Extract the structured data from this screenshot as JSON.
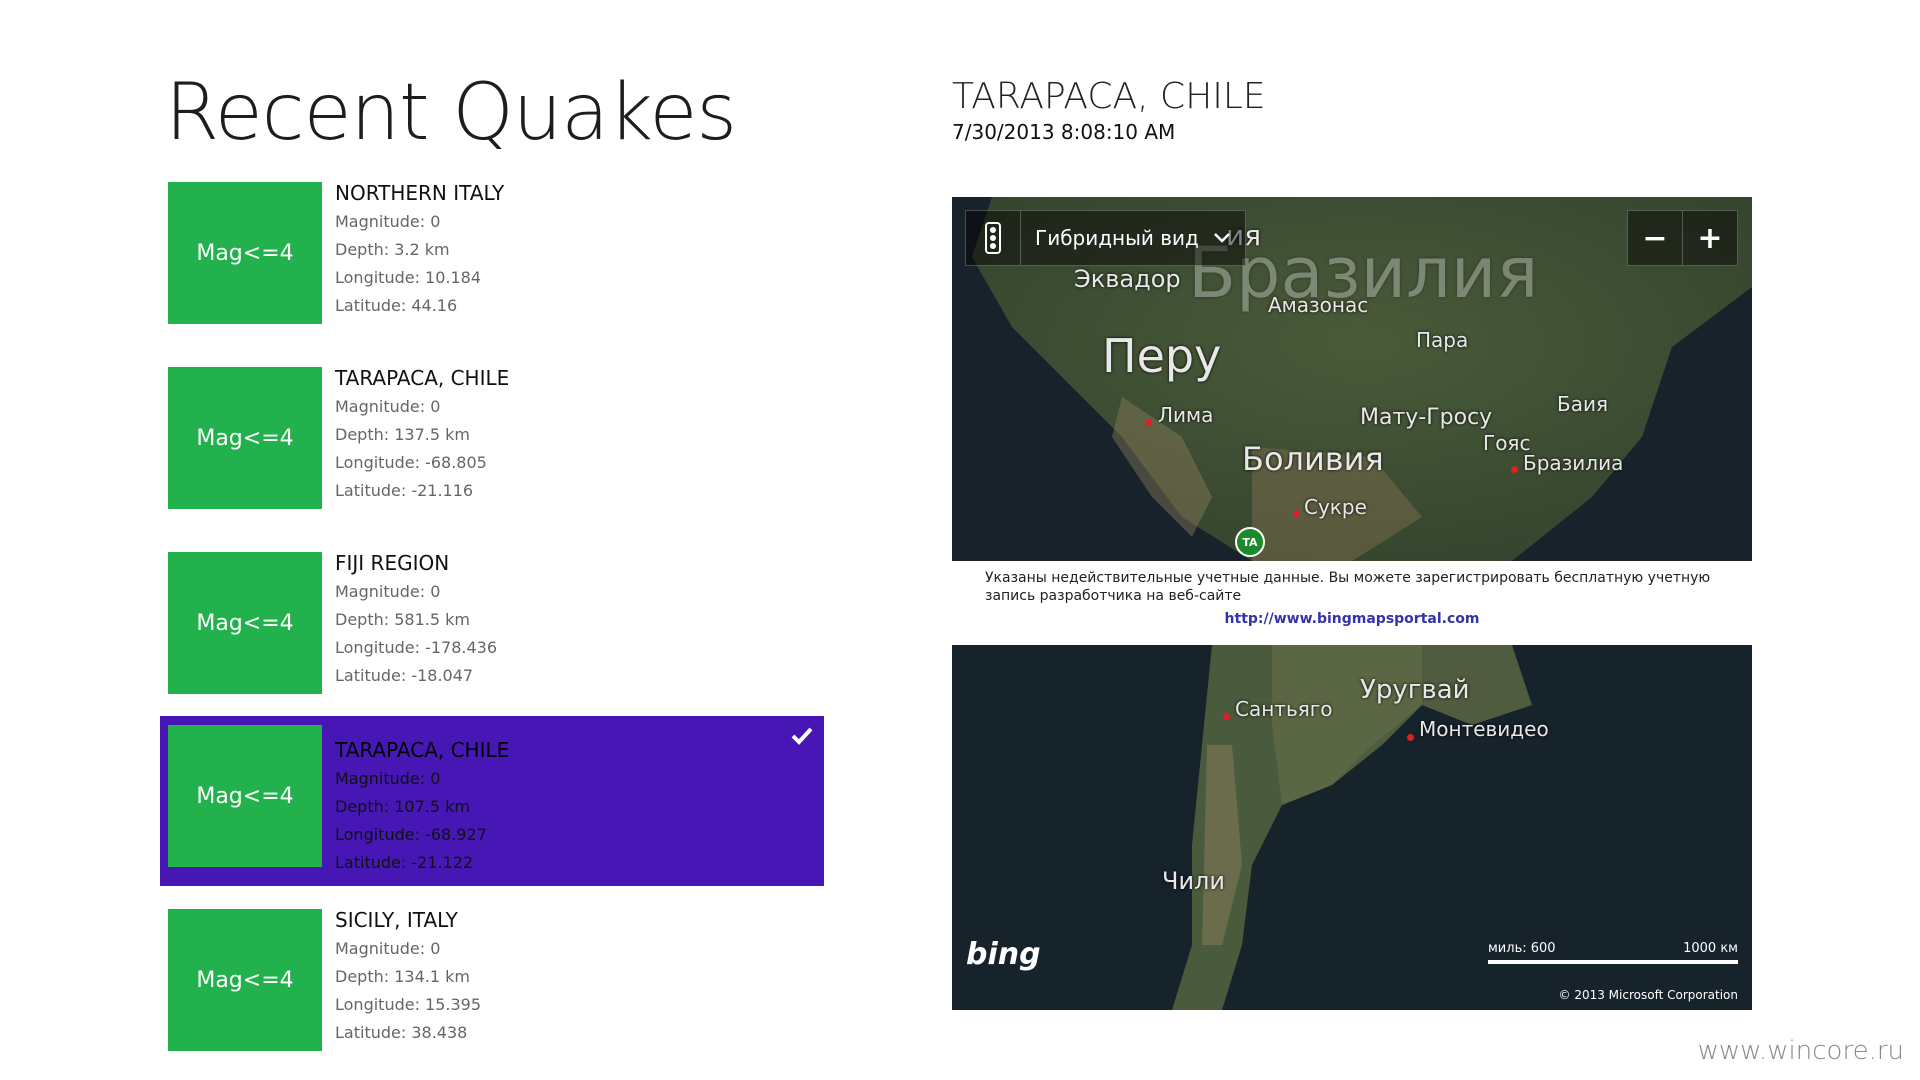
{
  "page": {
    "title": "Recent Quakes"
  },
  "quakes": [
    {
      "tile": "Mag<=4",
      "name": "NORTHERN ITALY",
      "magnitude": "Magnitude: 0",
      "depth": "Depth: 3.2 km",
      "longitude": "Longitude: 10.184",
      "latitude": "Latitude: 44.16",
      "selected": false
    },
    {
      "tile": "Mag<=4",
      "name": "TARAPACA, CHILE",
      "magnitude": "Magnitude: 0",
      "depth": "Depth: 137.5 km",
      "longitude": "Longitude: -68.805",
      "latitude": "Latitude: -21.116",
      "selected": false
    },
    {
      "tile": "Mag<=4",
      "name": "FIJI REGION",
      "magnitude": "Magnitude: 0",
      "depth": "Depth: 581.5 km",
      "longitude": "Longitude: -178.436",
      "latitude": "Latitude: -18.047",
      "selected": false
    },
    {
      "tile": "Mag<=4",
      "name": "TARAPACA, CHILE",
      "magnitude": "Magnitude: 0",
      "depth": "Depth: 107.5 km",
      "longitude": "Longitude: -68.927",
      "latitude": "Latitude: -21.122",
      "selected": true
    },
    {
      "tile": "Mag<=4",
      "name": "SICILY, ITALY",
      "magnitude": "Magnitude: 0",
      "depth": "Depth: 134.1 km",
      "longitude": "Longitude: 15.395",
      "latitude": "Latitude: 38.438",
      "selected": false
    }
  ],
  "detail": {
    "title": "TARAPACA, CHILE",
    "datetime": "7/30/2013 8:08:10 AM"
  },
  "map": {
    "view_label": "Гибридный вид",
    "zoom_out": "−",
    "zoom_in": "+",
    "marker_label": "TA",
    "warning_text": "Указаны недействительные учетные данные. Вы можете зарегистрировать бесплатную учетную запись разработчика на веб-сайте",
    "warning_link": "http://www.bingmapsportal.com",
    "logo": "bing",
    "scale_miles": "миль: 600",
    "scale_km": "1000 км",
    "copyright": "© 2013 Microsoft Corporation",
    "labels_top": [
      "Эквадор",
      "Бразилия",
      "Амазонас",
      "Пара",
      "Перу",
      "Лима",
      "Мату-Гросу",
      "Баия",
      "Гояс",
      "Бразилиа",
      "Боливия",
      "Сукре",
      "ия"
    ],
    "labels_bottom": [
      "Уругвай",
      "Сантьяго",
      "Монтевидео",
      "Чили"
    ]
  },
  "watermark": "www.wincore.ru",
  "colors": {
    "tile_green": "#22b14c",
    "selected_purple": "#4617b4"
  }
}
